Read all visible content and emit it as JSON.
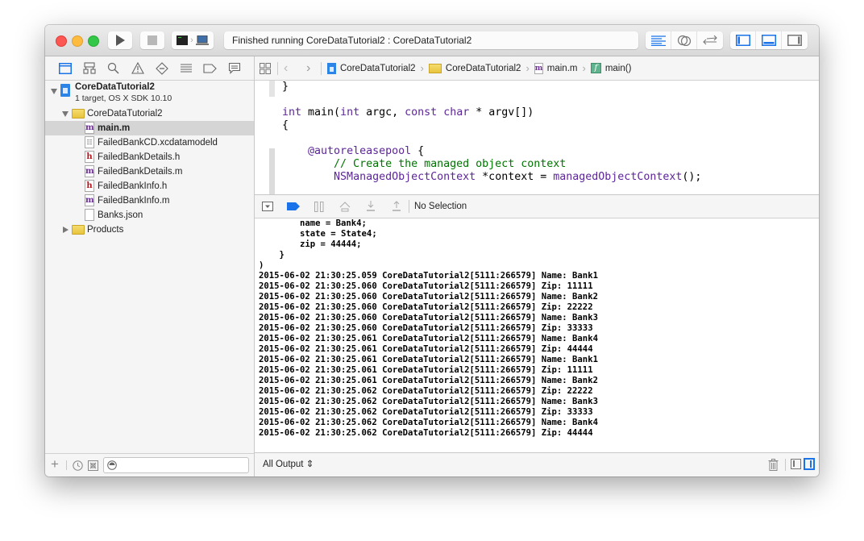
{
  "toolbar": {
    "activity_text": "Finished running CoreDataTutorial2 : CoreDataTutorial2",
    "run_icon": "play-icon",
    "stop_icon": "stop-icon",
    "scheme_icons": [
      "terminal-icon",
      "laptop-icon"
    ],
    "editor_modes": [
      "standard-editor-icon",
      "assistant-editor-icon",
      "version-editor-icon"
    ],
    "view_toggles": [
      "navigator-toggle-icon",
      "debug-area-toggle-icon",
      "utilities-toggle-icon"
    ],
    "accent_color": "#1a73e8"
  },
  "navigator": {
    "tabs": [
      "project-navigator-icon",
      "symbol-navigator-icon",
      "find-navigator-icon",
      "issue-navigator-icon",
      "test-navigator-icon",
      "debug-navigator-icon",
      "breakpoint-navigator-icon",
      "report-navigator-icon"
    ],
    "project": {
      "name": "CoreDataTutorial2",
      "subtitle": "1 target, OS X SDK 10.10"
    },
    "group": "CoreDataTutorial2",
    "files": [
      {
        "name": "main.m",
        "type": "m",
        "selected": true
      },
      {
        "name": "FailedBankCD.xcdatamodeld",
        "type": "xcdatamodel",
        "selected": false
      },
      {
        "name": "FailedBankDetails.h",
        "type": "h",
        "selected": false
      },
      {
        "name": "FailedBankDetails.m",
        "type": "m",
        "selected": false
      },
      {
        "name": "FailedBankInfo.h",
        "type": "h",
        "selected": false
      },
      {
        "name": "FailedBankInfo.m",
        "type": "m",
        "selected": false
      },
      {
        "name": "Banks.json",
        "type": "json",
        "selected": false
      }
    ],
    "products_group": "Products",
    "filter_placeholder": ""
  },
  "jumpbar": {
    "crumbs": [
      "CoreDataTutorial2",
      "CoreDataTutorial2",
      "main.m",
      "main()"
    ]
  },
  "code": {
    "lines": [
      "}",
      "",
      "int main(int argc, const char * argv[])",
      "{",
      "",
      "    @autoreleasepool {",
      "        // Create the managed object context",
      "        NSManagedObjectContext *context = managedObjectContext();"
    ]
  },
  "debug": {
    "selection_label": "No Selection"
  },
  "console": {
    "lines": [
      "        name = Bank4;",
      "        state = State4;",
      "        zip = 44444;",
      "    }",
      ")",
      "2015-06-02 21:30:25.059 CoreDataTutorial2[5111:266579] Name: Bank1",
      "2015-06-02 21:30:25.060 CoreDataTutorial2[5111:266579] Zip: 11111",
      "2015-06-02 21:30:25.060 CoreDataTutorial2[5111:266579] Name: Bank2",
      "2015-06-02 21:30:25.060 CoreDataTutorial2[5111:266579] Zip: 22222",
      "2015-06-02 21:30:25.060 CoreDataTutorial2[5111:266579] Name: Bank3",
      "2015-06-02 21:30:25.060 CoreDataTutorial2[5111:266579] Zip: 33333",
      "2015-06-02 21:30:25.061 CoreDataTutorial2[5111:266579] Name: Bank4",
      "2015-06-02 21:30:25.061 CoreDataTutorial2[5111:266579] Zip: 44444",
      "2015-06-02 21:30:25.061 CoreDataTutorial2[5111:266579] Name: Bank1",
      "2015-06-02 21:30:25.061 CoreDataTutorial2[5111:266579] Zip: 11111",
      "2015-06-02 21:30:25.061 CoreDataTutorial2[5111:266579] Name: Bank2",
      "2015-06-02 21:30:25.062 CoreDataTutorial2[5111:266579] Zip: 22222",
      "2015-06-02 21:30:25.062 CoreDataTutorial2[5111:266579] Name: Bank3",
      "2015-06-02 21:30:25.062 CoreDataTutorial2[5111:266579] Zip: 33333",
      "2015-06-02 21:30:25.062 CoreDataTutorial2[5111:266579] Name: Bank4",
      "2015-06-02 21:30:25.062 CoreDataTutorial2[5111:266579] Zip: 44444"
    ],
    "output_filter": "All Output ⇕"
  }
}
